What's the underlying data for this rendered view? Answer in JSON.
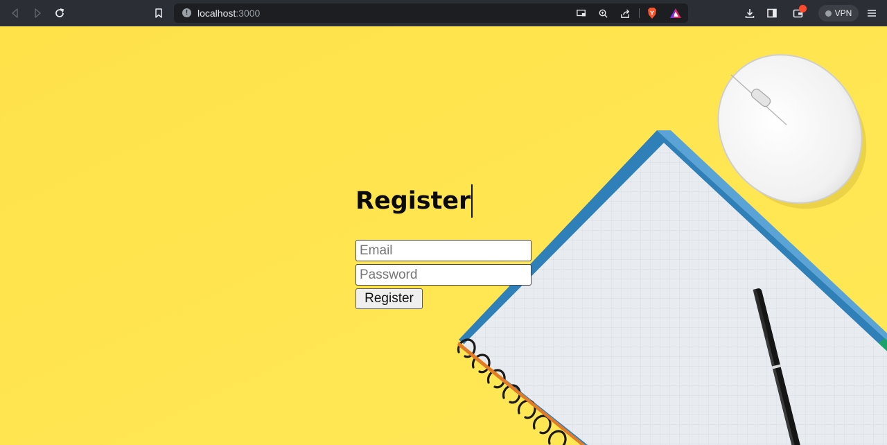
{
  "browser": {
    "url_host": "localhost",
    "url_port": ":3000",
    "vpn_label": "VPN",
    "icons": [
      "back-icon",
      "forward-icon",
      "reload-icon",
      "bookmark-icon",
      "site-info-icon",
      "cast-icon",
      "zoom-icon",
      "share-icon",
      "brave-shields-icon",
      "brave-rewards-icon",
      "download-icon",
      "sidebar-icon",
      "wallet-icon",
      "vpn-icon",
      "menu-icon"
    ]
  },
  "form": {
    "title": "Register",
    "email_placeholder": "Email",
    "password_placeholder": "Password",
    "submit_label": "Register"
  },
  "colors": {
    "background": "#ffe548",
    "toolbar": "#2b2e35",
    "urlbar": "#1c1e22"
  }
}
